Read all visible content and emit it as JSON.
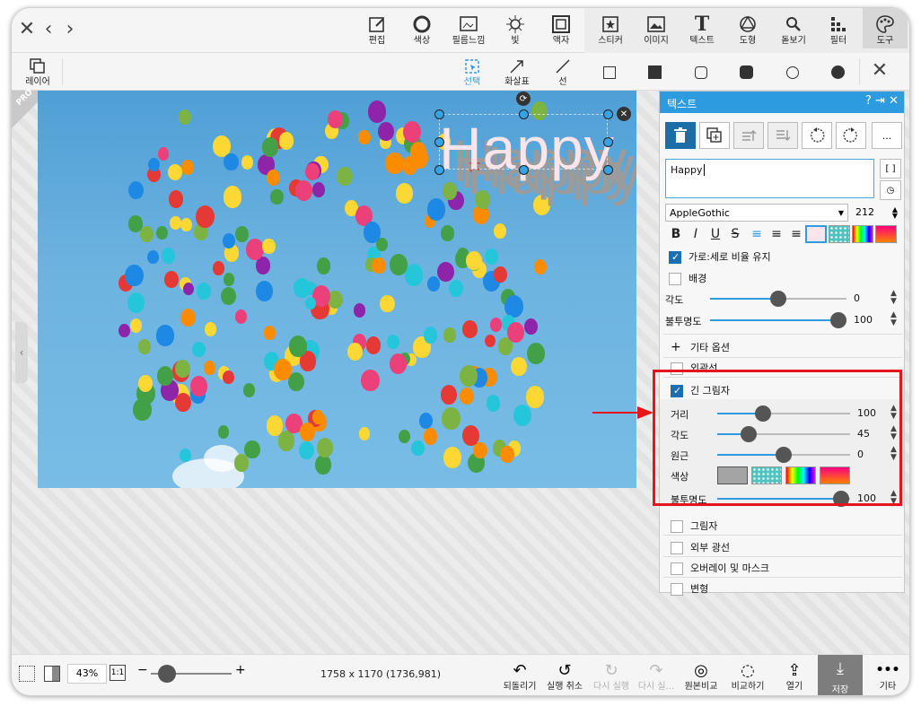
{
  "toolbar": {
    "items": [
      {
        "label": "편집",
        "icon": "edit-icon"
      },
      {
        "label": "색상",
        "icon": "color-icon"
      },
      {
        "label": "필름느낌",
        "icon": "film-icon"
      },
      {
        "label": "빛",
        "icon": "light-icon"
      },
      {
        "label": "액자",
        "icon": "frame-icon"
      },
      {
        "label": "스티커",
        "icon": "sticker-icon"
      },
      {
        "label": "이미지",
        "icon": "image-icon"
      },
      {
        "label": "텍스트",
        "icon": "text-icon"
      },
      {
        "label": "도형",
        "icon": "shape-icon"
      },
      {
        "label": "돋보기",
        "icon": "magnifier-icon"
      },
      {
        "label": "필터",
        "icon": "filter-icon"
      },
      {
        "label": "도구",
        "icon": "palette-icon"
      }
    ]
  },
  "subtoolbar": {
    "layer": "레이어",
    "select": "선택",
    "arrow": "화살표",
    "line": "선"
  },
  "canvas": {
    "pro_badge": "PRO",
    "text_content": "Happy"
  },
  "panel": {
    "title": "텍스트",
    "text_value": "Happy",
    "bracket_btn": "[ ]",
    "font": "AppleGothic",
    "font_size": "212",
    "keep_ratio": "가로:세로 비율 유지",
    "background": "배경",
    "angle_label": "각도",
    "angle_value": "0",
    "opacity_label": "불투명도",
    "opacity_value": "100",
    "other_options": "기타 옵션",
    "outline": "외곽선",
    "long_shadow": "긴 그림자",
    "ls_distance_label": "거리",
    "ls_distance_value": "100",
    "ls_angle_label": "각도",
    "ls_angle_value": "45",
    "ls_perspective_label": "원근",
    "ls_perspective_value": "0",
    "ls_color_label": "색상",
    "ls_opacity_label": "불투명도",
    "ls_opacity_value": "100",
    "shadow": "그림자",
    "outer_glow": "외부 광선",
    "overlay_mask": "오버레이 및 마스크",
    "transform": "변형",
    "more": "..."
  },
  "bottom": {
    "zoom": "43%",
    "ratio_btn": "1:1",
    "dimensions": "1758 x 1170 (1736,981)",
    "revert": "되돌리기",
    "undo": "실행 취소",
    "redo": "다시 실행",
    "redo_all": "다시 실...",
    "compare_original": "원본비교",
    "compare": "비교하기",
    "open": "열기",
    "save": "저장",
    "more": "기타"
  },
  "colors": {
    "accent": "#2d9be0",
    "highlight": "#e8141c",
    "swatch_gray": "#a4a4a4"
  }
}
